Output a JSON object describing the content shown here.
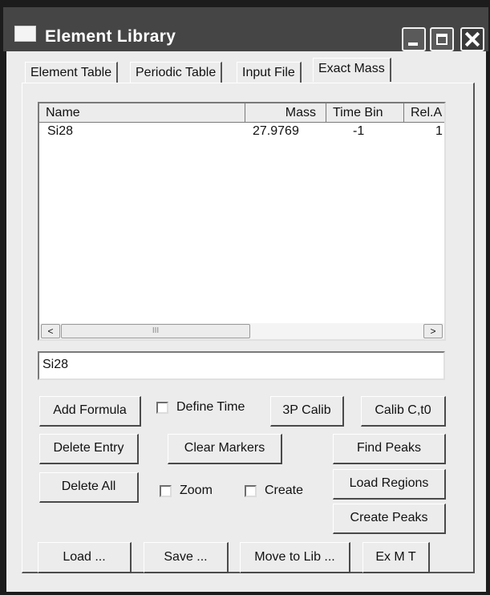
{
  "window": {
    "title": "Element Library"
  },
  "tabs": [
    "Element Table",
    "Periodic Table",
    "Input File",
    "Exact Mass"
  ],
  "active_tab": "Exact Mass",
  "list": {
    "columns": [
      "Name",
      "Mass",
      "Time Bin",
      "Rel.A"
    ],
    "rows": [
      {
        "name": "Si28",
        "mass": "27.9769",
        "time_bin": "-1",
        "rel": "1"
      }
    ]
  },
  "scroll": {
    "left_glyph": "<",
    "right_glyph": ">",
    "thumb_grip": "III"
  },
  "formula_input": {
    "value": "Si28"
  },
  "buttons": {
    "add_formula": "Add Formula",
    "calib_3p": "3P Calib",
    "calib_ct0": "Calib C,t0",
    "delete_entry": "Delete Entry",
    "clear_markers": "Clear Markers",
    "find_peaks": "Find Peaks",
    "delete_all": "Delete All",
    "load_regions": "Load Regions",
    "create_peaks": "Create Peaks",
    "load": "Load ...",
    "save": "Save ...",
    "move_to_lib": "Move to Lib ...",
    "ex_m_t": "Ex M T"
  },
  "checkboxes": {
    "define_time": {
      "label": "Define Time",
      "checked": false
    },
    "zoom": {
      "label": "Zoom",
      "checked": false
    },
    "create": {
      "label": "Create",
      "checked": false
    }
  }
}
